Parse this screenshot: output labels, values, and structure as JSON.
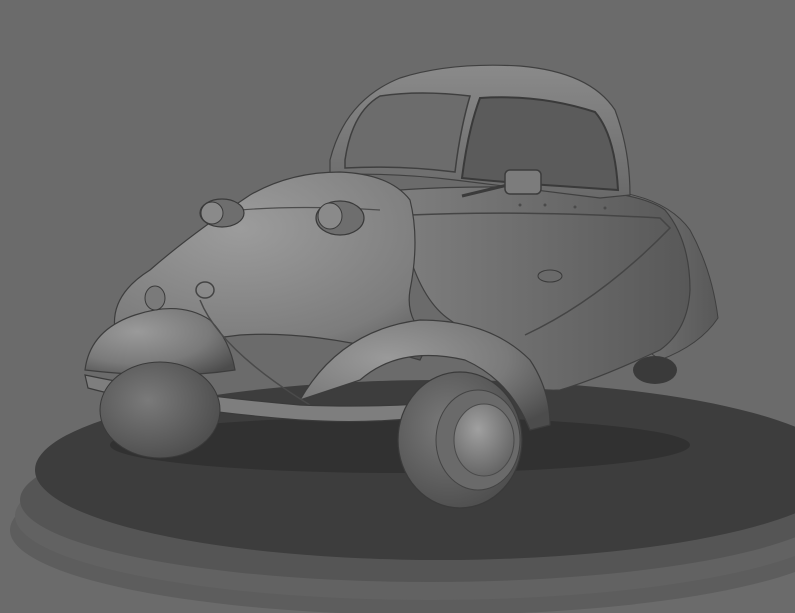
{
  "scene": {
    "subject": "bubble-car-3d-render",
    "colors": {
      "background": "#6b6b6b",
      "pedestal_top": "#3c3c3c",
      "pedestal_rim": "#5a5a5a",
      "body_light": "#8e8e8e",
      "body_mid": "#767676",
      "body_dark": "#4a4a4a",
      "glass": "#5c5c5c",
      "tire": "#5e5e5e",
      "hubcap": "#858585"
    },
    "icons": {
      "car": "car-model",
      "pedestal": "turntable-platform"
    }
  }
}
